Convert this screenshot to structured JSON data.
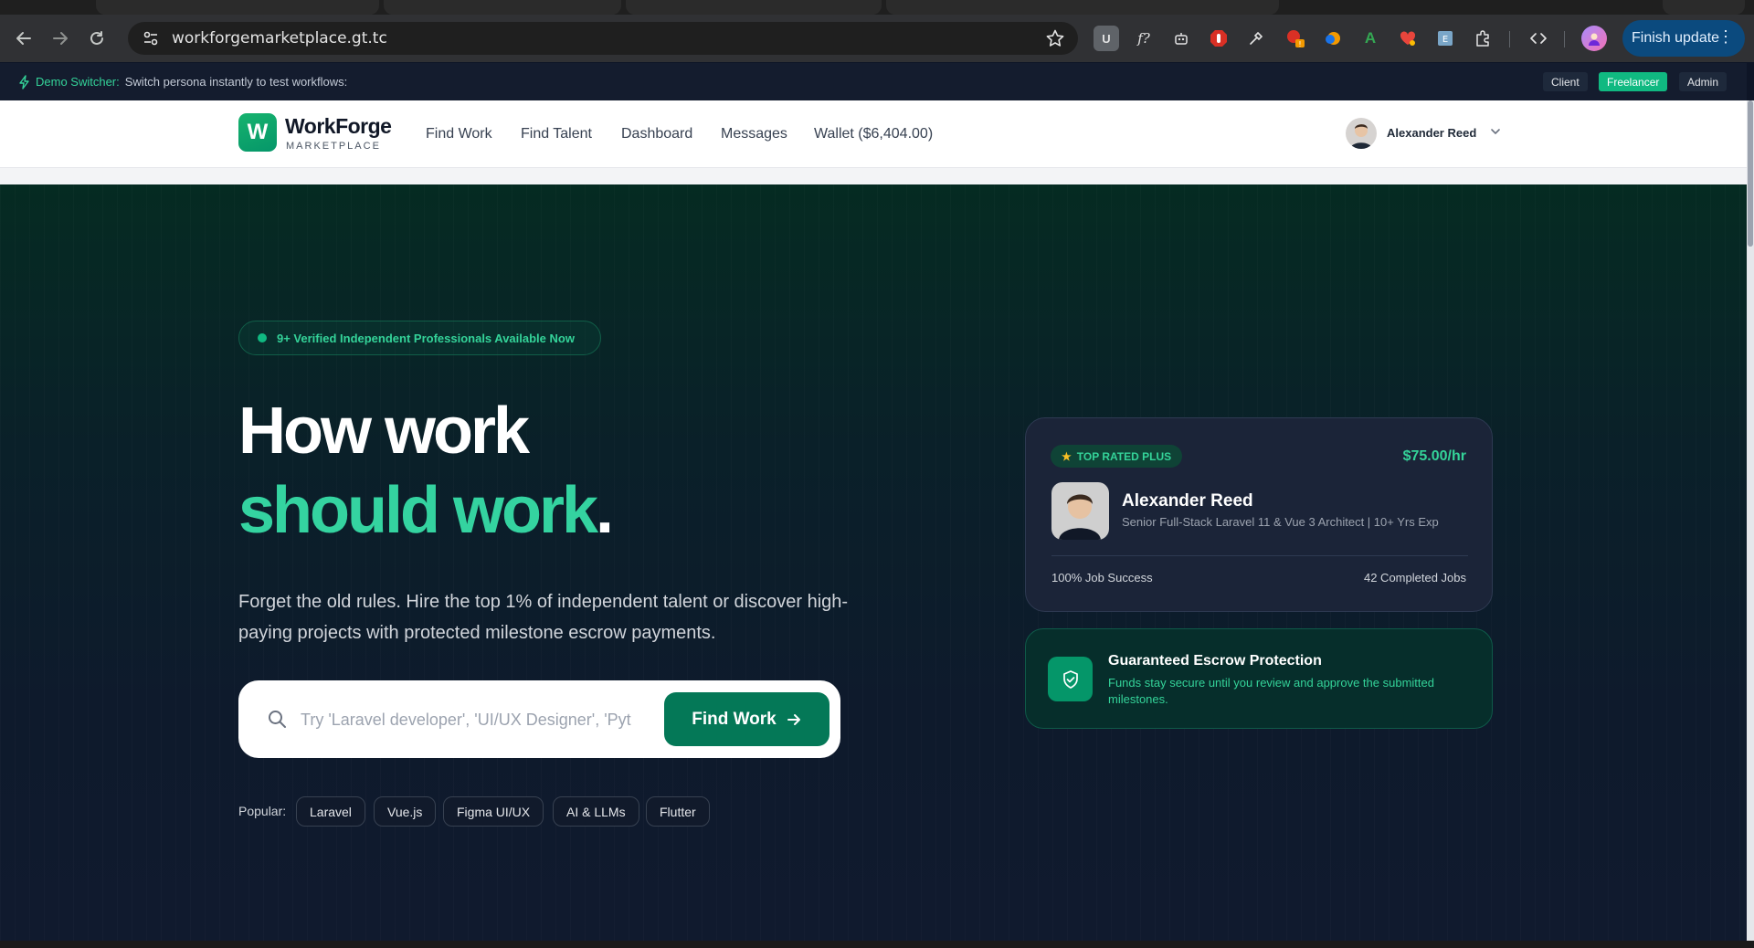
{
  "browser": {
    "url": "workforgemarketplace.gt.tc",
    "finish_update_label": "Finish update"
  },
  "demo_bar": {
    "label": "Demo Switcher:",
    "description": "Switch persona instantly to test workflows:",
    "personas": [
      "Client",
      "Freelancer",
      "Admin"
    ],
    "active_persona": "Freelancer"
  },
  "header": {
    "logo_letter": "W",
    "brand_name": "WorkForge",
    "brand_sub": "MARKETPLACE",
    "nav": [
      "Find Work",
      "Find Talent",
      "Dashboard",
      "Messages",
      "Wallet ($6,404.00)"
    ],
    "user_name": "Alexander Reed"
  },
  "hero": {
    "badge": "9+ Verified Independent Professionals Available Now",
    "headline_line1": "How work",
    "headline_line2_green": "should work",
    "headline_line2_period": ".",
    "lead": "Forget the old rules. Hire the top 1% of independent talent or discover high-paying projects with protected milestone escrow payments.",
    "search_placeholder": "Try 'Laravel developer', 'UI/UX Designer', 'Pyt",
    "search_button": "Find Work",
    "popular_label": "Popular:",
    "popular_tags": [
      "Laravel",
      "Vue.js",
      "Figma UI/UX",
      "AI & LLMs",
      "Flutter"
    ]
  },
  "pro_card": {
    "badge": "TOP RATED PLUS",
    "rate": "$75.00/hr",
    "name": "Alexander Reed",
    "title": "Senior Full-Stack Laravel 11 & Vue 3 Architect | 10+ Yrs Exp",
    "job_success": "100% Job Success",
    "completed_jobs": "42 Completed Jobs"
  },
  "escrow_card": {
    "title": "Guaranteed Escrow Protection",
    "description": "Funds stay secure until you review and approve the submitted milestones."
  },
  "colors": {
    "accent_green": "#10b981",
    "headline_green": "#34d3a0",
    "hero_bg": "#0e1a2c",
    "finish_update_bg": "#0b4a7e"
  }
}
